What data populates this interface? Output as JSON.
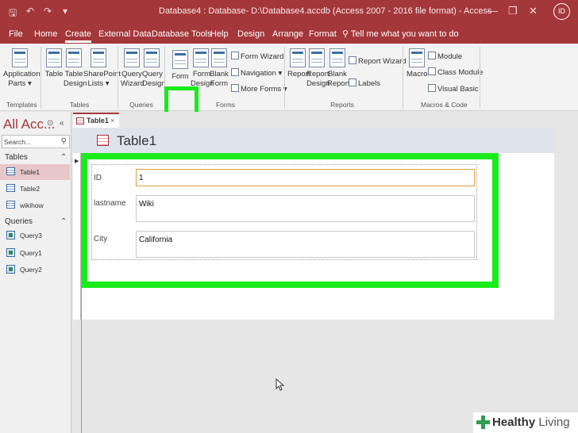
{
  "titlebar": {
    "title": "Database4 : Database- D:\\Database4.accdb (Access 2007 - 2016 file format)  -  Access",
    "user_initials": "ID",
    "save_glyph": "🖫",
    "undo_glyph": "↶",
    "redo_glyph": "↷",
    "dropdown_glyph": "▾",
    "minimize_glyph": "—",
    "restore_glyph": "❐",
    "close_glyph": "✕"
  },
  "tabs": [
    {
      "label": "File"
    },
    {
      "label": "Home"
    },
    {
      "label": "Create"
    },
    {
      "label": "External Data"
    },
    {
      "label": "Database Tools"
    },
    {
      "label": "Help"
    },
    {
      "label": "Design"
    },
    {
      "label": "Arrange"
    },
    {
      "label": "Format"
    }
  ],
  "tell_me": "Tell me what you want to do",
  "ribbon": {
    "application_parts": "Application\nParts ▾",
    "table": "Table",
    "table_design": "Table\nDesign",
    "sharepoint_lists": "SharePoint\nLists ▾",
    "query_wizard": "Query\nWizard",
    "query_design": "Query\nDesign",
    "form": "Form",
    "form_design": "Form\nDesign",
    "blank_form": "Blank\nForm",
    "form_wizard": "Form Wizard",
    "navigation": "Navigation ▾",
    "more_forms": "More Forms ▾",
    "report": "Report",
    "report_design": "Report\nDesign",
    "blank_report": "Blank\nReport",
    "report_wizard": "Report Wizard",
    "labels": "Labels",
    "macro": "Macro",
    "module": "Module",
    "class_module": "Class Module",
    "visual_basic": "Visual Basic",
    "groups": {
      "templates": "Templates",
      "tables": "Tables",
      "queries": "Queries",
      "forms": "Forms",
      "reports": "Reports",
      "macros_code": "Macros & Code"
    }
  },
  "nav": {
    "header": "All Acc...",
    "search_placeholder": "Search...",
    "tables_header": "Tables",
    "tables": [
      "Table1",
      "Table2",
      "wikihow"
    ],
    "queries_header": "Queries",
    "queries": [
      "Query3",
      "Query1",
      "Query2"
    ]
  },
  "document": {
    "tab_label": "Table1",
    "tab_close": "×",
    "form_title": "Table1"
  },
  "fields": [
    {
      "label": "ID",
      "value": "1"
    },
    {
      "label": "lastname",
      "value": "Wiki"
    },
    {
      "label": "City",
      "value": "California"
    }
  ],
  "watermark": {
    "brand_bold": "Healthy",
    "brand_light": " Living"
  },
  "colors": {
    "accent": "#a4373a",
    "highlight": "#1aeb1a"
  }
}
